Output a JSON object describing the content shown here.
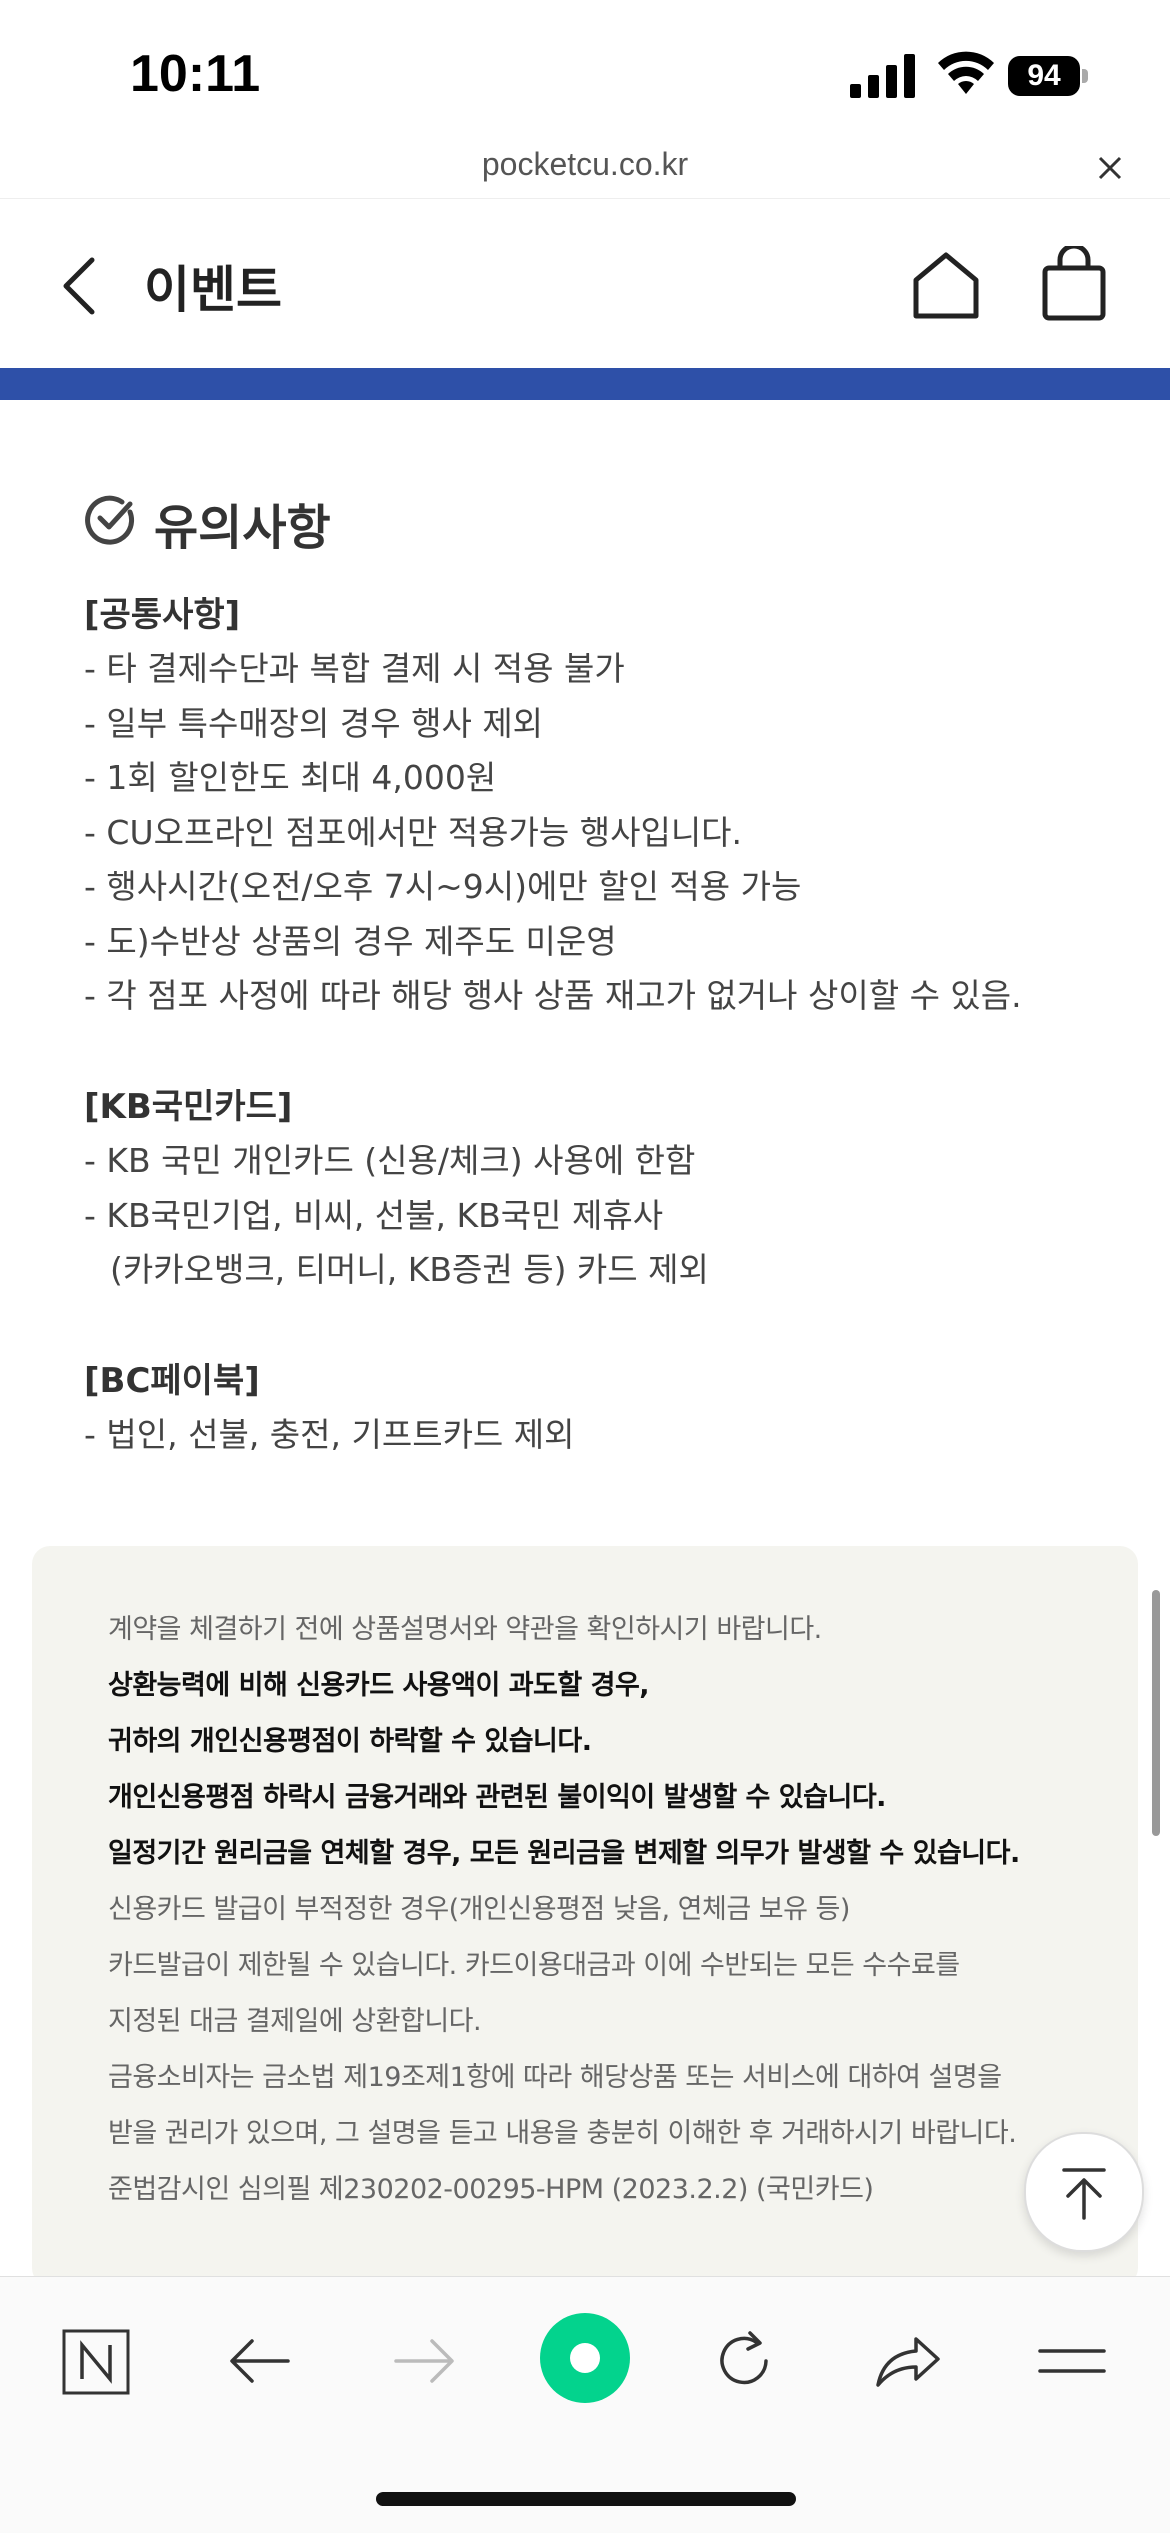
{
  "status_bar": {
    "time": "10:11",
    "battery": "94"
  },
  "url_bar": {
    "domain": "pocketcu.co.kr"
  },
  "header": {
    "title": "이벤트"
  },
  "notice": {
    "heading": "유의사항",
    "sections": [
      {
        "title": "[공통사항]",
        "items": [
          "- 타 결제수단과 복합 결제 시 적용 불가",
          "- 일부 특수매장의 경우 행사 제외",
          "- 1회 할인한도 최대 4,000원",
          "- CU오프라인 점포에서만 적용가능 행사입니다.",
          "- 행사시간(오전/오후 7시~9시)에만 할인 적용 가능",
          "- 도)수반상 상품의 경우 제주도 미운영",
          "- 각 점포 사정에 따라 해당 행사 상품 재고가 없거나 상이할 수 있음."
        ]
      },
      {
        "title": "[KB국민카드]",
        "items": [
          "- KB 국민 개인카드 (신용/체크) 사용에 한함",
          "- KB국민기업, 비씨, 선불, KB국민 제휴사",
          "(카카오뱅크, 티머니, KB증권 등) 카드 제외"
        ]
      },
      {
        "title": "[BC페이북]",
        "items": [
          "- 법인, 선불, 충전, 기프트카드 제외"
        ]
      }
    ]
  },
  "disclaimer": {
    "lines": [
      "계약을 체결하기 전에 상품설명서와 약관을 확인하시기 바랍니다.",
      "상환능력에 비해 신용카드 사용액이 과도할 경우,",
      "귀하의 개인신용평점이 하락할 수 있습니다.",
      "개인신용평점 하락시 금융거래와 관련된 불이익이 발생할 수 있습니다.",
      "일정기간 원리금을 연체할 경우, 모든 원리금을 변제할 의무가 발생할 수 있습니다.",
      "신용카드 발급이 부적정한 경우(개인신용평점 낮음, 연체금 보유 등)",
      "카드발급이 제한될 수 있습니다. 카드이용대금과 이에 수반되는 모든 수수료를",
      "지정된 대금 결제일에 상환합니다.",
      "금융소비자는 금소법 제19조제1항에 따라 해당상품 또는 서비스에 대하여 설명을",
      "받을 권리가 있으며, 그 설명을 듣고 내용을 충분히 이해한 후 거래하시기 바랍니다.",
      "준법감시인 심의필 제230202-00295-HPM (2023.2.2) (국민카드)"
    ]
  },
  "colors": {
    "accent_blue": "#2e50a8",
    "naver_green": "#03d38d",
    "disclaimer_bg": "#f4f4ef"
  },
  "toolbar_icons": [
    "naver-n-icon",
    "back-arrow-icon",
    "forward-arrow-icon",
    "green-dot-icon",
    "refresh-icon",
    "share-icon",
    "menu-icon"
  ]
}
